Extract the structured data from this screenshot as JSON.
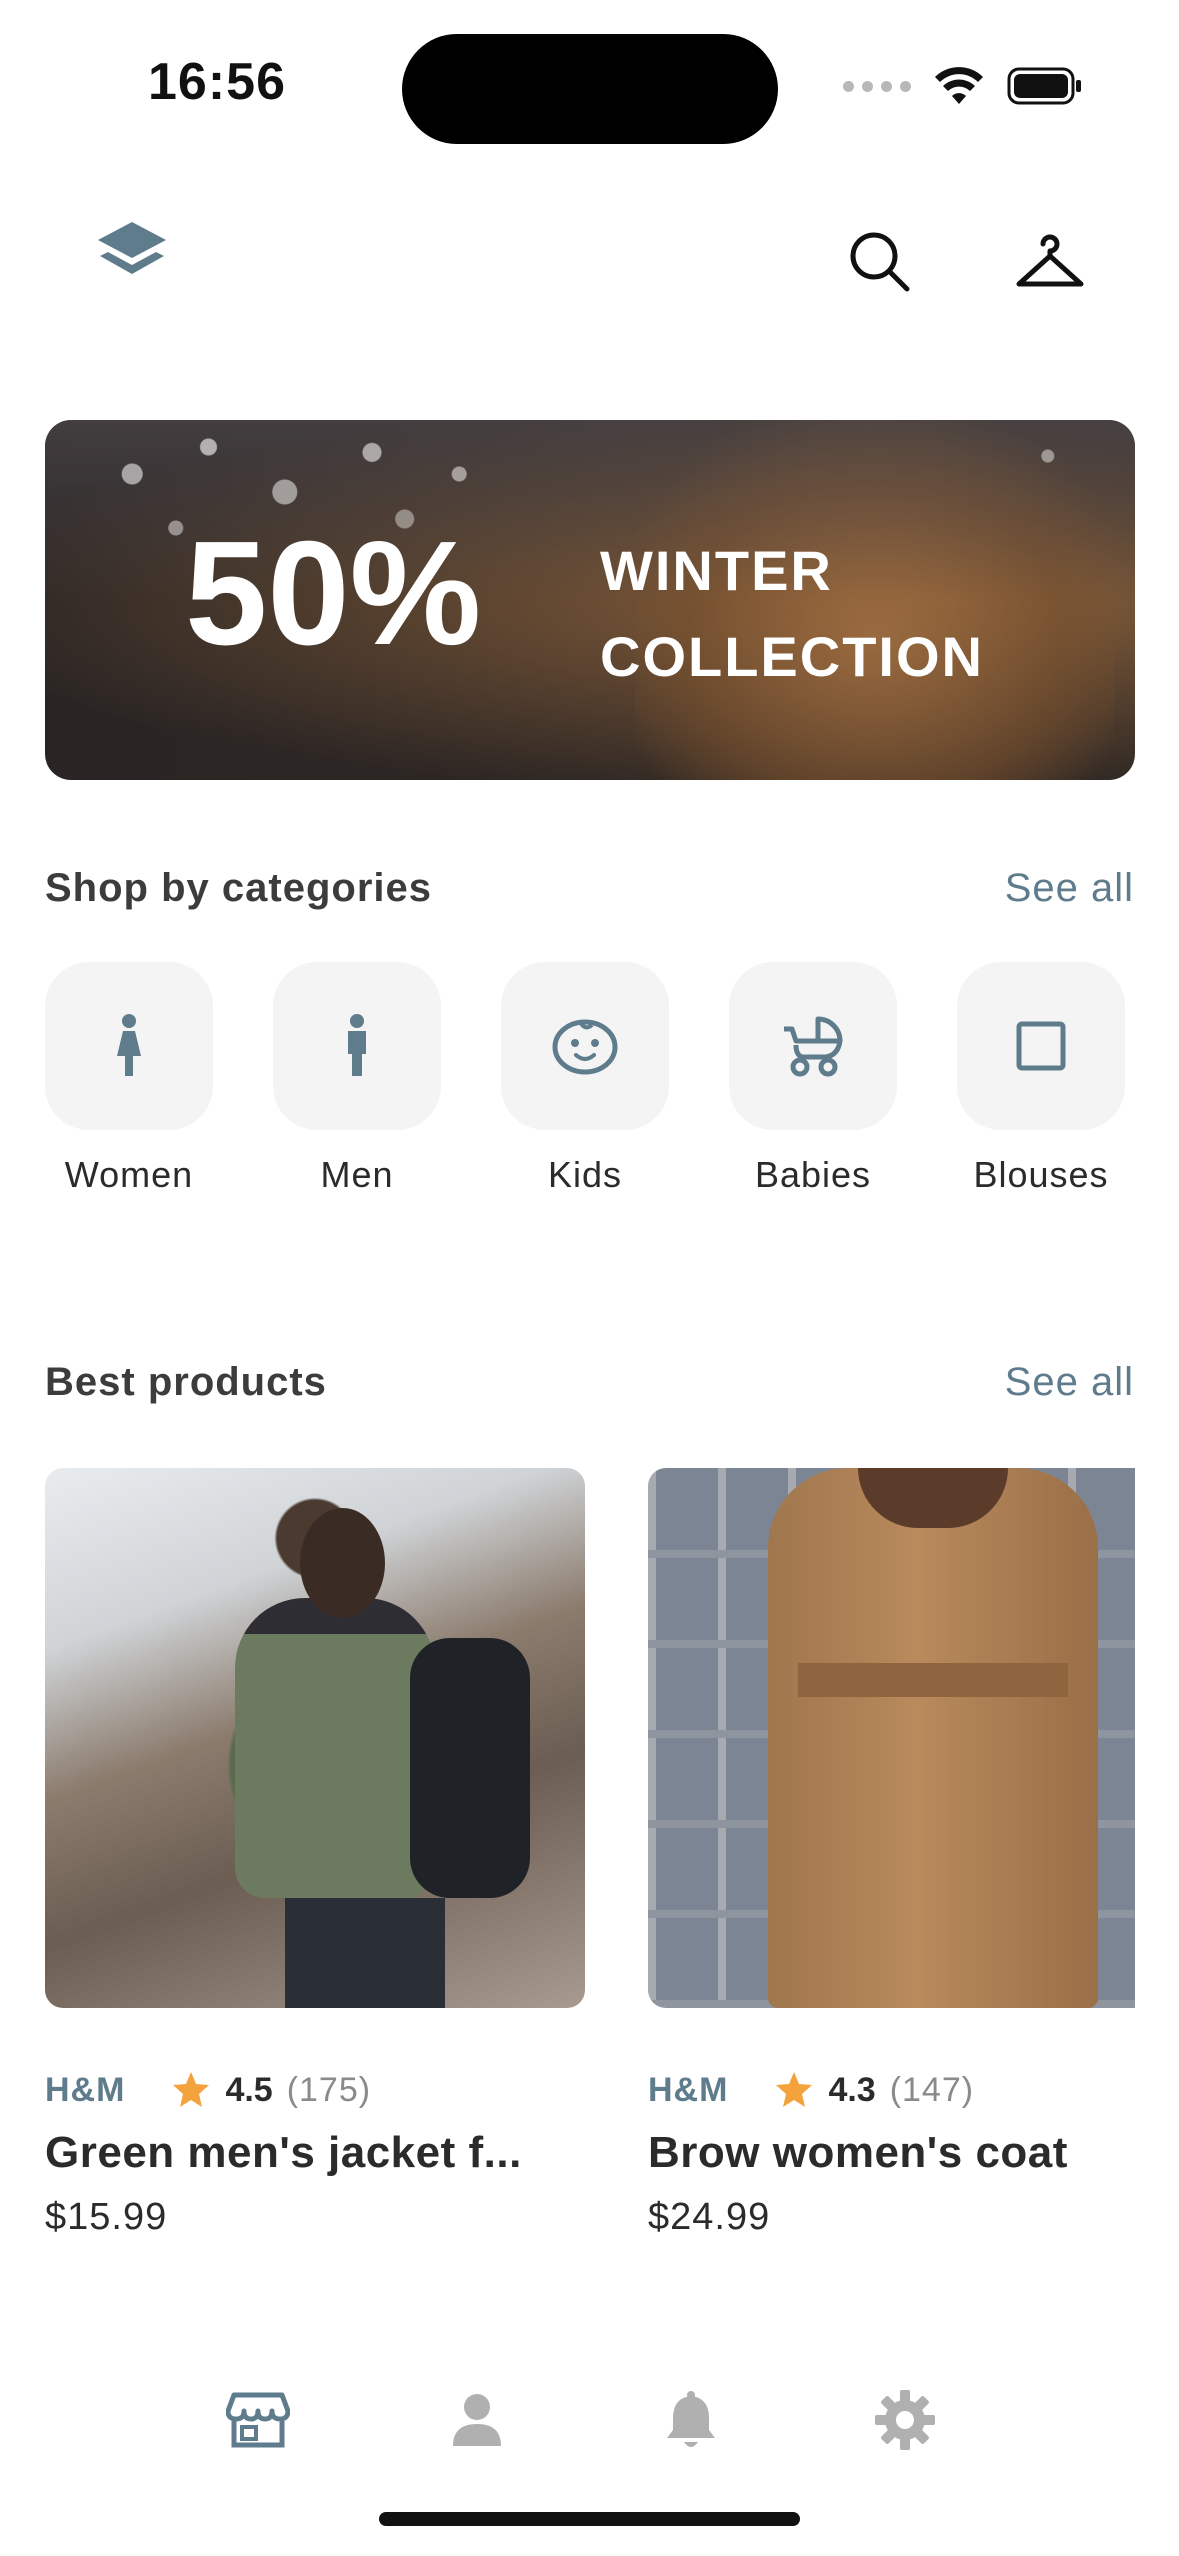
{
  "status_bar": {
    "time": "16:56"
  },
  "colors": {
    "accent": "#5f7c8c",
    "tile_bg": "#f4f4f4",
    "star": "#f4a23c",
    "inactive_tab": "#b0b0b0"
  },
  "header": {
    "logo_icon": "layers-icon",
    "search_icon": "search-icon",
    "wardrobe_icon": "hanger-icon"
  },
  "banner": {
    "percent": "50%",
    "title_line1": "WINTER",
    "title_line2": "COLLECTION"
  },
  "categories_section": {
    "title": "Shop by categories",
    "see_all": "See all",
    "items": [
      {
        "label": "Women",
        "icon": "woman-icon"
      },
      {
        "label": "Men",
        "icon": "man-icon"
      },
      {
        "label": "Kids",
        "icon": "child-face-icon"
      },
      {
        "label": "Babies",
        "icon": "stroller-icon"
      },
      {
        "label": "Blouses",
        "icon": "square-icon"
      }
    ]
  },
  "products_section": {
    "title": "Best products",
    "see_all": "See all",
    "items": [
      {
        "brand": "H&M",
        "rating": "4.5",
        "reviews": "(175)",
        "name": "Green men's jacket f...",
        "price": "$15.99"
      },
      {
        "brand": "H&M",
        "rating": "4.3",
        "reviews": "(147)",
        "name": "Brow women's coat",
        "price": "$24.99"
      }
    ]
  },
  "tabbar": {
    "items": [
      {
        "icon": "store-icon",
        "active": true
      },
      {
        "icon": "person-icon",
        "active": false
      },
      {
        "icon": "bell-icon",
        "active": false
      },
      {
        "icon": "gear-icon",
        "active": false
      }
    ]
  }
}
